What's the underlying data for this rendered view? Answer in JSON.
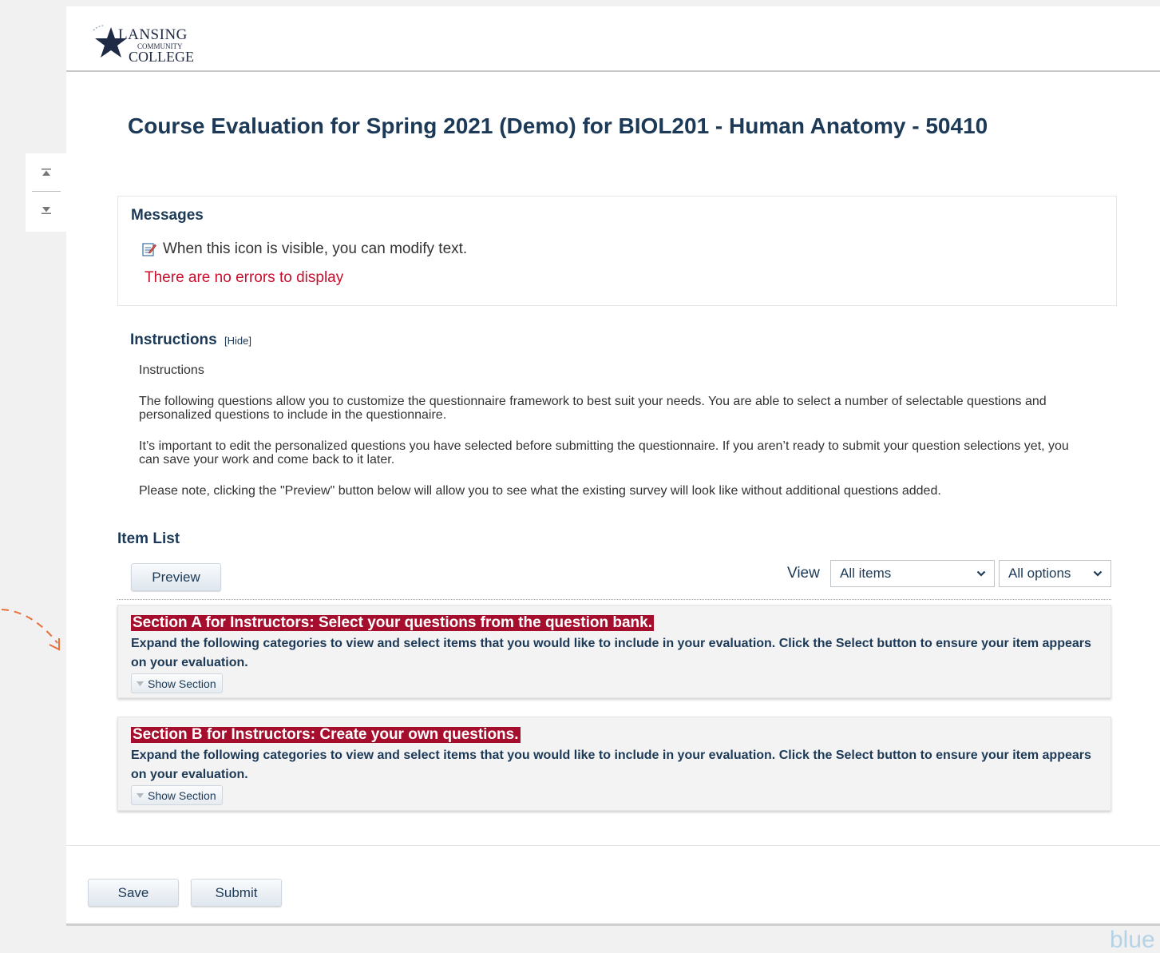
{
  "header": {
    "logo": {
      "line1": "LANSING",
      "line2": "COMMUNITY",
      "line3": "COLLEGE"
    }
  },
  "page": {
    "title": "Course Evaluation for Spring 2021 (Demo) for BIOL201 - Human Anatomy - 50410"
  },
  "messages": {
    "title": "Messages",
    "info": "When this icon is visible, you can modify text.",
    "error": "There are no errors to display",
    "info_icon": "edit-icon"
  },
  "instructions": {
    "title": "Instructions",
    "hide_link": "[Hide]",
    "paragraphs": [
      "Instructions",
      "The following questions allow you to customize the questionnaire framework to best suit your needs. You are able to select a number of selectable questions and personalized questions to include in the questionnaire.",
      "It’s important to edit the personalized questions you have selected before submitting the questionnaire. If you aren’t ready to submit your question selections yet, you can save your work and come back to it later.",
      "Please note, clicking the \"Preview\" button below will allow you to see what the existing survey will look like without additional questions added."
    ]
  },
  "item_list": {
    "title": "Item List",
    "preview_button": "Preview",
    "view_label": "View",
    "view_select": {
      "selected": "All items"
    },
    "options_select": {
      "selected": "All options"
    }
  },
  "sections": [
    {
      "heading": "Section A for Instructors: Select your questions from the question bank.",
      "description": "Expand the following categories to view and select items that you would like to include in your evaluation. Click the Select button to ensure your item appears on your evaluation.",
      "toggle_label": "Show Section"
    },
    {
      "heading": "Section B for Instructors: Create your own questions.",
      "description": "Expand the following categories to view and select items that you would like to include in your evaluation. Click the Select button to ensure your item appears on your evaluation.",
      "toggle_label": "Show Section"
    }
  ],
  "footer": {
    "save_button": "Save",
    "submit_button": "Submit",
    "brand_fragment": "blue"
  },
  "colors": {
    "title_navy": "#1c3a57",
    "section_heading_bg": "#a50f2d",
    "error_red": "#c8102e",
    "page_bg": "#f1f1f1",
    "decorative_arrow": "#e8703a"
  }
}
